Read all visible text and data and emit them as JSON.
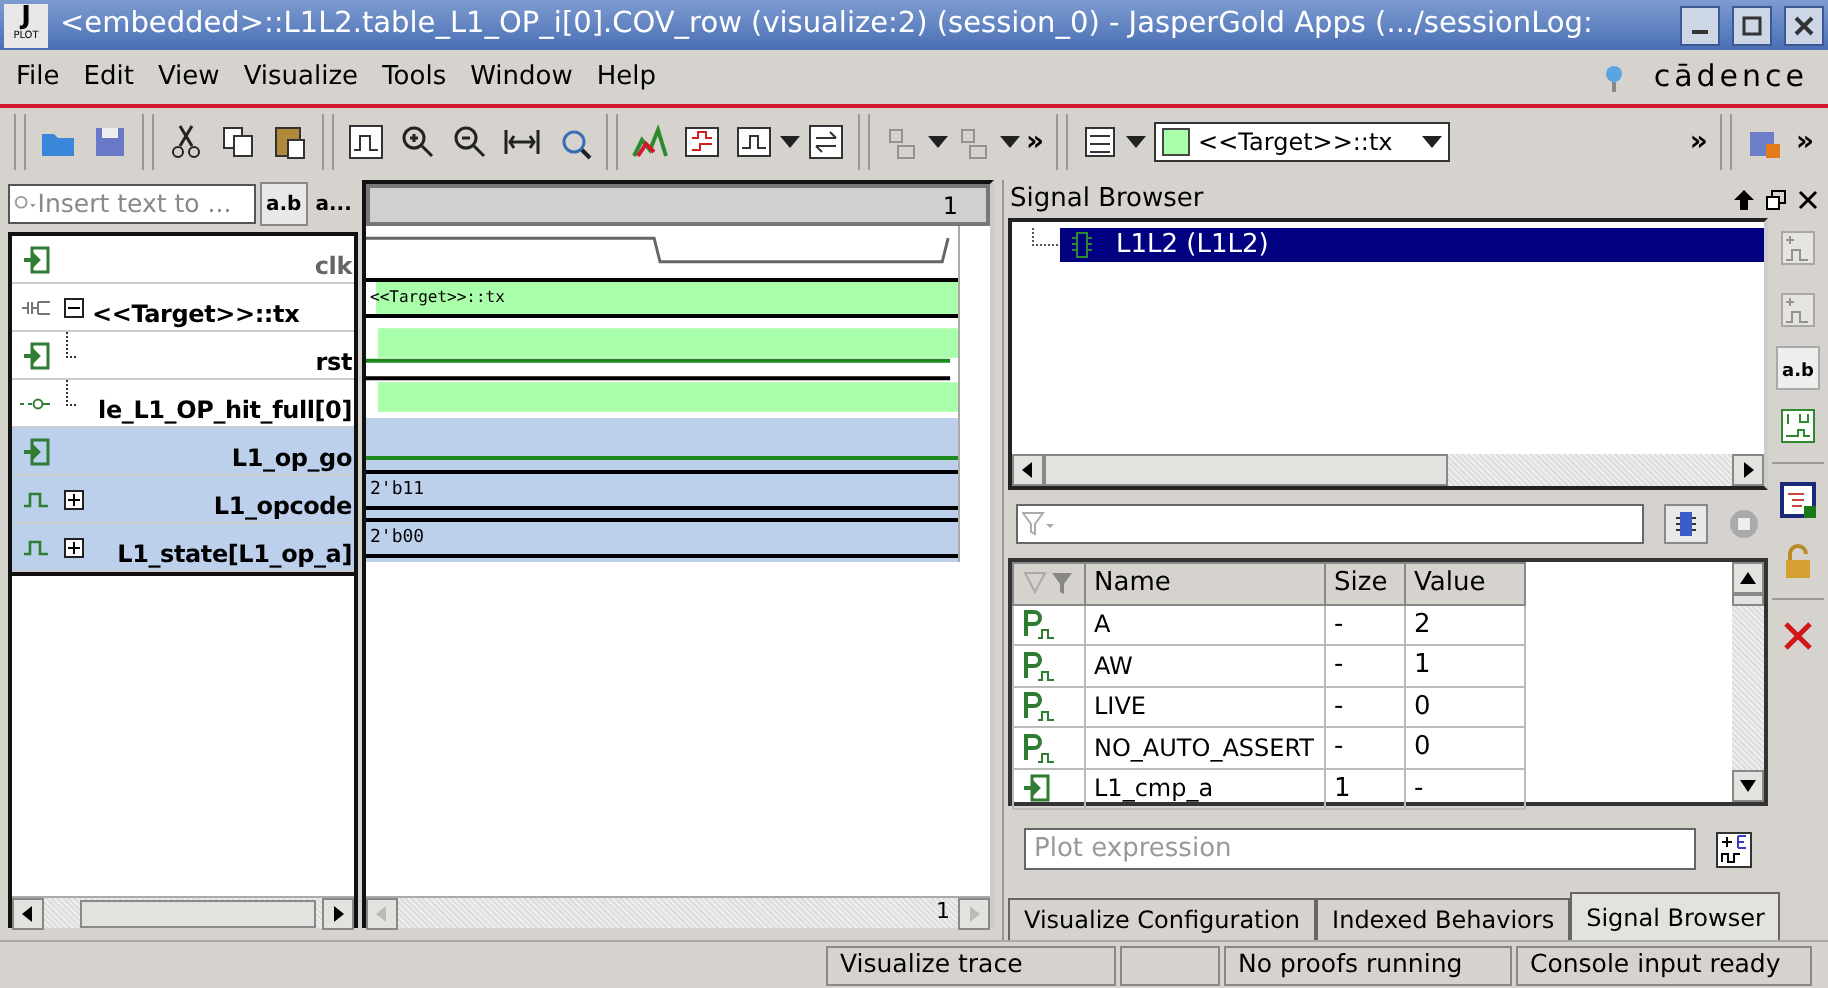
{
  "window": {
    "title": "<embedded>::L1L2.table_L1_OP_i[0].COV_row (visualize:2) (session_0) - JasperGold Apps (.../sessionLog:",
    "logo": "J",
    "logo_caption": "PLOT"
  },
  "menu": [
    "File",
    "Edit",
    "View",
    "Visualize",
    "Tools",
    "Window",
    "Help"
  ],
  "brand": "cādence",
  "toolbar": {
    "target_combo": {
      "value": "<<Target>>::tx"
    },
    "overflow": [
      "»",
      "»",
      "»"
    ]
  },
  "signal_list": {
    "search": {
      "placeholder": "Insert text to ..."
    },
    "buttons": [
      {
        "label": "a.b",
        "selected": true
      },
      {
        "label": "a...",
        "selected": false
      }
    ],
    "signals": [
      {
        "name": "clk",
        "kind": "input",
        "wave": {
          "kind": "clock"
        },
        "selected": false
      },
      {
        "name": "<<Target>>::tx",
        "kind": "group",
        "expanded": true,
        "wave": {
          "kind": "bus_filled",
          "label": "<<Target>>::tx"
        },
        "selected": false,
        "children": [
          {
            "name": "rst",
            "kind": "input",
            "wave": {
              "kind": "fill_low"
            },
            "selected": false
          },
          {
            "name": "le_L1_OP_hit_full[0]",
            "kind": "property",
            "wave": {
              "kind": "fill_high"
            },
            "selected": false
          }
        ]
      },
      {
        "name": "L1_op_go",
        "kind": "input",
        "wave": {
          "kind": "low"
        },
        "selected": true
      },
      {
        "name": "L1_opcode",
        "kind": "register",
        "expanded": false,
        "wave": {
          "kind": "bus",
          "label": "2'b11"
        },
        "selected": true
      },
      {
        "name": "L1_state[L1_op_a]",
        "kind": "register",
        "expanded": false,
        "wave": {
          "kind": "bus",
          "label": "2'b00"
        },
        "selected": true
      }
    ]
  },
  "waveform": {
    "cursor_label": "1",
    "scroll_label": "1"
  },
  "signal_browser": {
    "title": "Signal Browser",
    "tree": [
      {
        "label": "L1L2 (L1L2)",
        "selected": true
      }
    ],
    "table": {
      "columns": [
        "Name",
        "Size",
        "Value"
      ],
      "rows": [
        {
          "kind": "parameter",
          "name": "A",
          "size": "-",
          "value": "2"
        },
        {
          "kind": "parameter",
          "name": "AW",
          "size": "-",
          "value": "1"
        },
        {
          "kind": "parameter",
          "name": "LIVE",
          "size": "-",
          "value": "0"
        },
        {
          "kind": "parameter",
          "name": "NO_AUTO_ASSERT",
          "size": "-",
          "value": "0"
        },
        {
          "kind": "input",
          "name": "L1_cmp_a",
          "size": "1",
          "value": "-"
        }
      ]
    },
    "plot_expression": {
      "placeholder": "Plot expression"
    },
    "side_label": "a.b"
  },
  "tabs": [
    {
      "label": "Visualize Configuration",
      "selected": false
    },
    {
      "label": "Indexed Behaviors",
      "selected": false
    },
    {
      "label": "Signal Browser",
      "selected": true
    }
  ],
  "status_bar": [
    "Visualize trace",
    "No proofs running",
    "Console input ready"
  ]
}
